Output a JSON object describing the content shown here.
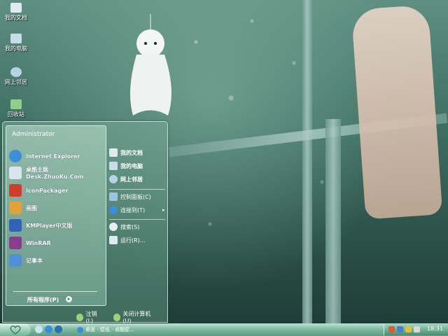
{
  "desktop": {
    "icons": [
      {
        "label": "我的文档",
        "icon": "my-documents-icon",
        "color": "#dfe9ef"
      },
      {
        "label": "我的电脑",
        "icon": "my-computer-icon",
        "color": "#c9dbe6"
      },
      {
        "label": "网上邻居",
        "icon": "network-places-icon",
        "color": "#b7d2e4"
      },
      {
        "label": "回收站",
        "icon": "recycle-bin-icon",
        "color": "#8fcf8a"
      }
    ]
  },
  "start_menu": {
    "user_name": "Administrator",
    "programs": [
      {
        "label": "Internet Explorer",
        "icon": "internet-explorer-icon",
        "color": "#3b8fd9"
      },
      {
        "label": "桌酷主题Desk.ZhuoKu.Com",
        "icon": "zhuoku-theme-icon",
        "color": "#d9e4f0"
      },
      {
        "label": "IconPackager",
        "icon": "iconpackager-icon",
        "color": "#d23a2a"
      },
      {
        "label": "画图",
        "icon": "paint-icon",
        "color": "#e2a13a"
      },
      {
        "label": "KMPlayer中文版",
        "icon": "kmplayer-icon",
        "color": "#2f63b5"
      },
      {
        "label": "WinRAR",
        "icon": "winrar-icon",
        "color": "#8a3c8e"
      },
      {
        "label": "记事本",
        "icon": "notepad-icon",
        "color": "#4f90d6"
      }
    ],
    "all_programs_label": "所有程序(P)",
    "places": [
      {
        "label": "我的文档",
        "icon": "my-documents-icon"
      },
      {
        "label": "我的电脑",
        "icon": "my-computer-icon"
      },
      {
        "label": "网上邻居",
        "icon": "network-places-icon"
      }
    ],
    "system": [
      {
        "label": "控制面板(C)",
        "icon": "control-panel-icon"
      },
      {
        "label": "连接到(T)",
        "icon": "connect-to-icon",
        "submenu": "▸"
      }
    ],
    "tools": [
      {
        "label": "搜索(S)",
        "icon": "search-icon"
      },
      {
        "label": "运行(R)...",
        "icon": "run-icon"
      }
    ],
    "logoff_label": "注销(L)",
    "shutdown_label": "关闭计算机(U)"
  },
  "taskbar": {
    "tasks": [
      {
        "label": "桌面 - 壁纸 - 桌酷壁...",
        "icon": "browser-window-icon"
      }
    ],
    "clock": "18:31"
  },
  "colors": {
    "accent": "#6fb297",
    "taskbar": "#7fb9a2"
  }
}
